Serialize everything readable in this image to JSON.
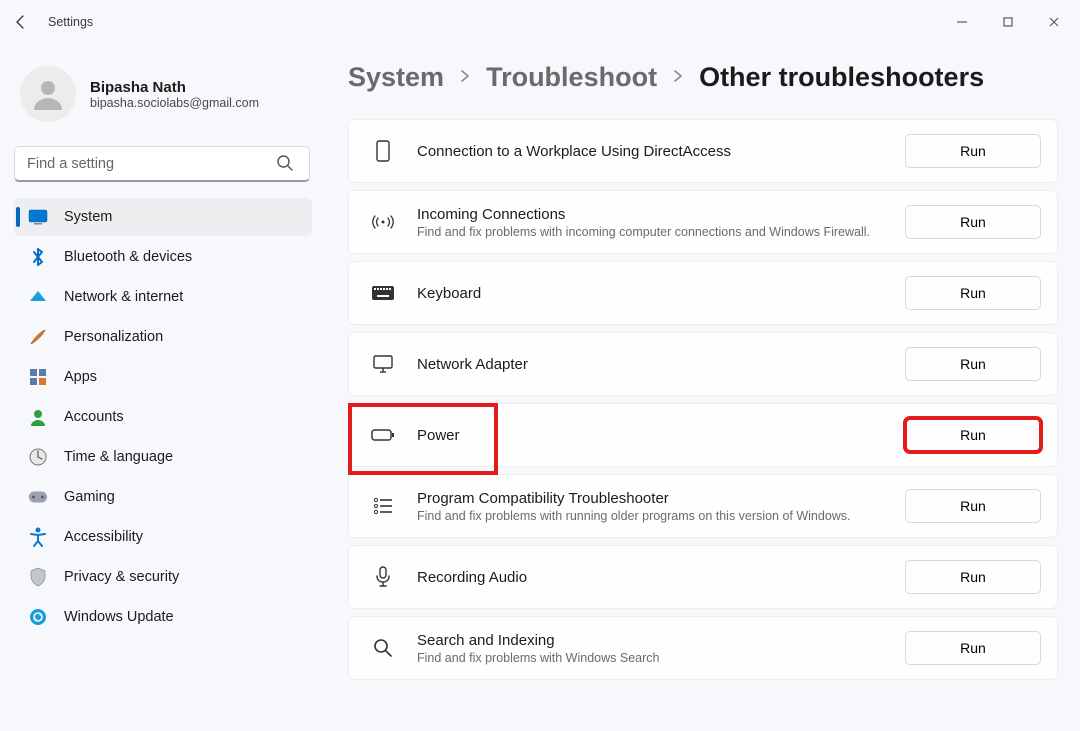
{
  "app": {
    "title": "Settings"
  },
  "user": {
    "name": "Bipasha Nath",
    "email": "bipasha.sociolabs@gmail.com"
  },
  "search": {
    "placeholder": "Find a setting"
  },
  "nav": {
    "items": [
      {
        "label": "System"
      },
      {
        "label": "Bluetooth & devices"
      },
      {
        "label": "Network & internet"
      },
      {
        "label": "Personalization"
      },
      {
        "label": "Apps"
      },
      {
        "label": "Accounts"
      },
      {
        "label": "Time & language"
      },
      {
        "label": "Gaming"
      },
      {
        "label": "Accessibility"
      },
      {
        "label": "Privacy & security"
      },
      {
        "label": "Windows Update"
      }
    ]
  },
  "breadcrumb": {
    "a": "System",
    "b": "Troubleshoot",
    "c": "Other troubleshooters"
  },
  "buttons": {
    "run": "Run"
  },
  "troubleshooters": [
    {
      "title": "Connection to a Workplace Using DirectAccess",
      "sub": ""
    },
    {
      "title": "Incoming Connections",
      "sub": "Find and fix problems with incoming computer connections and Windows Firewall."
    },
    {
      "title": "Keyboard",
      "sub": ""
    },
    {
      "title": "Network Adapter",
      "sub": ""
    },
    {
      "title": "Power",
      "sub": ""
    },
    {
      "title": "Program Compatibility Troubleshooter",
      "sub": "Find and fix problems with running older programs on this version of Windows."
    },
    {
      "title": "Recording Audio",
      "sub": ""
    },
    {
      "title": "Search and Indexing",
      "sub": "Find and fix problems with Windows Search"
    }
  ]
}
